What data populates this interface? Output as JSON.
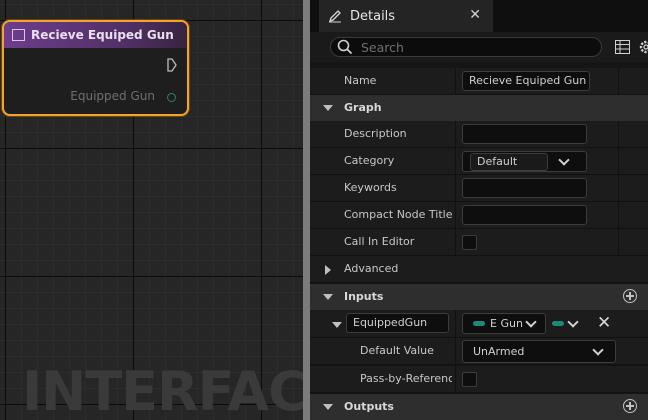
{
  "graph": {
    "watermark": "INTERFACE",
    "node": {
      "title": "Recieve Equiped Gun",
      "pin_label": "Equipped Gun"
    }
  },
  "details": {
    "tab_label": "Details",
    "search_placeholder": "Search",
    "name_label": "Name",
    "name_value": "Recieve Equiped Gun",
    "graph_section": {
      "label": "Graph",
      "description_label": "Description",
      "description_value": "",
      "category_label": "Category",
      "category_value": "Default",
      "keywords_label": "Keywords",
      "keywords_value": "",
      "compact_title_label": "Compact Node Title",
      "compact_title_value": "",
      "call_in_editor_label": "Call In Editor",
      "call_in_editor_checked": false
    },
    "advanced_label": "Advanced",
    "inputs_section": {
      "label": "Inputs",
      "param_name": "EquippedGun",
      "param_type": "E Gun",
      "default_value_label": "Default Value",
      "default_value": "UnArmed",
      "pass_by_ref_label": "Pass-by-Reference",
      "pass_by_ref_checked": false
    },
    "outputs_label": "Outputs",
    "colors": {
      "node_border": "#f0a531",
      "node_header": "#6e3d8e",
      "enum_pin": "#1c8a7a"
    }
  }
}
